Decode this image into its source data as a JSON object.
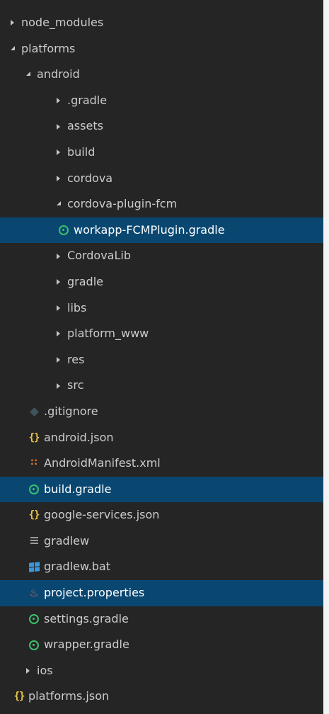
{
  "explorer": {
    "items": [
      {
        "label": "node_modules",
        "type": "folder",
        "state": "collapsed",
        "depth": 0
      },
      {
        "label": "platforms",
        "type": "folder",
        "state": "expanded",
        "depth": 0
      },
      {
        "label": "android",
        "type": "folder",
        "state": "expanded",
        "depth": 1
      },
      {
        "label": ".gradle",
        "type": "folder",
        "state": "collapsed",
        "depth": 2
      },
      {
        "label": "assets",
        "type": "folder",
        "state": "collapsed",
        "depth": 2
      },
      {
        "label": "build",
        "type": "folder",
        "state": "collapsed",
        "depth": 2
      },
      {
        "label": "cordova",
        "type": "folder",
        "state": "collapsed",
        "depth": 2
      },
      {
        "label": "cordova-plugin-fcm",
        "type": "folder",
        "state": "expanded",
        "depth": 2
      },
      {
        "label": "workapp-FCMPlugin.gradle",
        "type": "file",
        "icon": "gradle-icon",
        "selected": true,
        "depth": 3
      },
      {
        "label": "CordovaLib",
        "type": "folder",
        "state": "collapsed",
        "depth": 2
      },
      {
        "label": "gradle",
        "type": "folder",
        "state": "collapsed",
        "depth": 2
      },
      {
        "label": "libs",
        "type": "folder",
        "state": "collapsed",
        "depth": 2
      },
      {
        "label": "platform_www",
        "type": "folder",
        "state": "collapsed",
        "depth": 2
      },
      {
        "label": "res",
        "type": "folder",
        "state": "collapsed",
        "depth": 2
      },
      {
        "label": "src",
        "type": "folder",
        "state": "collapsed",
        "depth": 2
      },
      {
        "label": ".gitignore",
        "type": "file",
        "icon": "git-icon",
        "depth": 2
      },
      {
        "label": "android.json",
        "type": "file",
        "icon": "json-icon",
        "depth": 2
      },
      {
        "label": "AndroidManifest.xml",
        "type": "file",
        "icon": "rss-xml-icon",
        "depth": 2
      },
      {
        "label": "build.gradle",
        "type": "file",
        "icon": "gradle-icon",
        "selected": true,
        "depth": 2
      },
      {
        "label": "google-services.json",
        "type": "file",
        "icon": "json-icon",
        "depth": 2
      },
      {
        "label": "gradlew",
        "type": "file",
        "icon": "shell-icon",
        "depth": 2
      },
      {
        "label": "gradlew.bat",
        "type": "file",
        "icon": "windows-icon",
        "depth": 2
      },
      {
        "label": "project.properties",
        "type": "file",
        "icon": "java-icon",
        "selected": true,
        "depth": 2
      },
      {
        "label": "settings.gradle",
        "type": "file",
        "icon": "gradle-icon",
        "depth": 2
      },
      {
        "label": "wrapper.gradle",
        "type": "file",
        "icon": "gradle-icon",
        "depth": 2
      },
      {
        "label": "ios",
        "type": "folder",
        "state": "collapsed",
        "depth": 1
      },
      {
        "label": "platforms.json",
        "type": "file",
        "icon": "json-icon",
        "depth": 0
      }
    ]
  },
  "colors": {
    "background": "#252526",
    "selection": "#094771",
    "text": "#cccccc",
    "json": "#e8c547",
    "gradle": "#3dc06a",
    "xml": "#e37933",
    "windows": "#3a96dd",
    "java": "#e26a4b"
  }
}
